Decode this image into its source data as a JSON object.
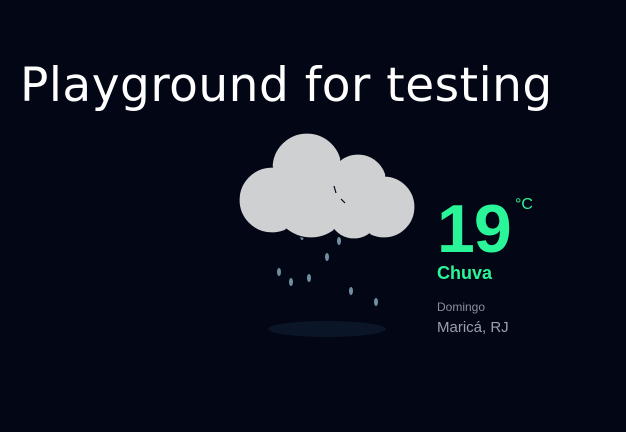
{
  "page": {
    "title": "Playground for testing"
  },
  "weather": {
    "temperature": "19",
    "unit": "°C",
    "condition": "Chuva",
    "day": "Domingo",
    "location": "Maricá, RJ",
    "icon": "rain-cloud-icon"
  },
  "colors": {
    "background": "#030615",
    "accent": "#2af598",
    "cloud": "#cfd0d2",
    "raindrop": "#6f8fa0",
    "muted_text": "#9aa0ad"
  }
}
